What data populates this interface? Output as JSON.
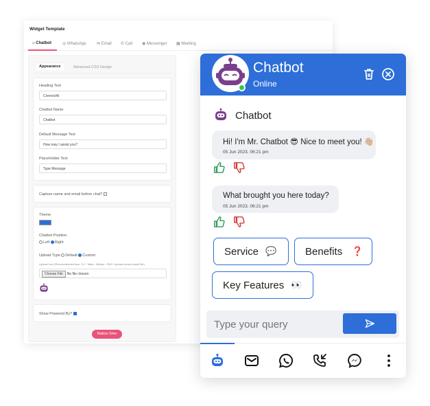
{
  "widget": {
    "title": "Widget Template",
    "tabs": [
      "Chatbot",
      "WhatsApp",
      "Email",
      "Call",
      "Messenger",
      "Meeting"
    ],
    "subtabs": [
      "Appearance",
      "Advanced CSS Design"
    ],
    "heading_label": "Heading Text",
    "heading_value": "ConnectAI",
    "name_label": "Chatbot Name",
    "name_value": "Chatbot",
    "default_msg_label": "Default Message Text",
    "default_msg_value": "How may I assist you?",
    "placeholder_label": "PlaceHolder Text",
    "placeholder_value": "Type Message",
    "capture_label": "Capture name and email before chat?",
    "theme_label": "Theme",
    "position_label": "Chatbot Position",
    "position_left": "Left",
    "position_right": "Right",
    "upload_type_label": "Upload Type",
    "upload_default": "Default",
    "upload_custom": "Custom",
    "upload_icon_label": "Upload Icon (Recommended size: 9:1 * https...Webpe...PNG. Upload.comp.ressed file)",
    "choose_file": "Choose File",
    "no_file": "No file chosen",
    "powered_label": "Show Powered By?",
    "save_label": "Nation Sme",
    "theme_color": "#2d6ed8",
    "accent_color": "#e9547a"
  },
  "chat": {
    "title": "Chatbot",
    "status": "Online",
    "bot_name": "Chatbot",
    "messages": [
      {
        "text": "Hi! I'm Mr. Chatbot 😎 Nice to meet you! 👋🏼",
        "time": "05 Jun 2023, 06:21 pm"
      },
      {
        "text": "What brought you here today?",
        "time": "05 Jun 2023, 06:21 pm"
      }
    ],
    "options": [
      {
        "label": "Service",
        "emoji": "💬"
      },
      {
        "label": "Benefits",
        "emoji": "❓"
      },
      {
        "label": "Key Features",
        "emoji": "👀"
      }
    ],
    "input_placeholder": "Type your query",
    "brand_color": "#2d6ed8",
    "footer_icons": [
      "bot-icon",
      "email-icon",
      "whatsapp-icon",
      "call-icon",
      "messenger-icon",
      "more-icon"
    ]
  }
}
